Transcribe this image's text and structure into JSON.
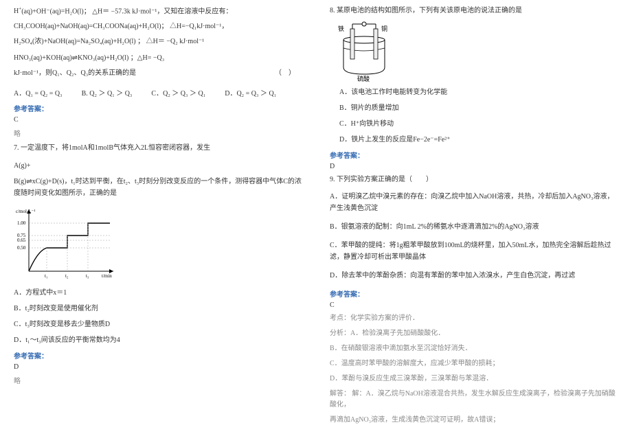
{
  "left": {
    "eq1_prefix": "H",
    "eq1": "(aq)+OH⁻(aq)=H₂O(l)； △H＝ −57.3k kJ·mol⁻¹，又知在溶液中反应有：",
    "eq2": "CH₃COOH(aq)+NaOH(aq)=CH₃COONa(aq)+H₂O(l)； △H=−Q₁kJ·mol⁻¹，",
    "eq3": "H₂SO₄(浓)+NaOH(aq)=Na₂SO₄(aq)+H₂O(l) ； △H＝ −Q₂ kJ·mol⁻¹",
    "eq4": "HNO₃(aq)+KOH(aq)⇌KNO₃(aq)+H₂O(l) ；△H= −Q₃",
    "eq5": "kJ·mol⁻¹，则Q₁、Q₂、Q₃的关系正确的是",
    "paren": "（　）",
    "optA": "A．Q₁ = Q₂ = Q₃",
    "optB": "B. Q₂ ＞ Q₁ ＞ Q₃",
    "optC": "C．Q₂ ＞ Q₃ ＞ Q₁",
    "optD": "D．Q₂ = Q₃ ＞ Q₁",
    "ans_label": "参考答案：",
    "ans6": "C",
    "omit": "略",
    "q7": "7. 一定温度下，将1molA和1molB气体充入2L恒容密闭容器，发生",
    "q7_eqA": "A(g)+",
    "q7_eqB": "B(g)⇌xC(g)+D(s)，t₁时达到平衡，在t₂、t₃时刻分别改变反应的一个条件，测得容器中气体C的浓度随时间变化如图所示，正确的是",
    "q7A": "A．方程式中x＝1",
    "q7B": "B．t₂时刻改变是使用催化剂",
    "q7C": "C．t₃时刻改变是移去少量物质D",
    "q7D": "D．t₁～t₃间该反应的平衡常数均为4",
    "ans7": "D"
  },
  "right": {
    "q8": "8. 某原电池的结构如图所示，下列有关该原电池的说法正确的是",
    "diag_label_left": "铁",
    "diag_label_right": "铜",
    "diag_label_bottom": "硫酸",
    "q8A": "A．该电池工作时电能转变为化学能",
    "q8B": "B．铜片的质量增加",
    "q8C": "C．H⁺向铁片移动",
    "q8D": "D．铁片上发生的反应是Fe−2e⁻=Fe²⁺",
    "ans_label": "参考答案：",
    "ans8": "D",
    "q9": "9. 下列实验方案正确的是（　　）",
    "q9A": "A．证明溴乙烷中溴元素的存在：向溴乙烷中加入NaOH溶液，共热，冷却后加入AgNO₃溶液，产生浅黄色沉淀",
    "q9B": "B．银氨溶液的配制：向1mL 2%的稀氨水中逐滴滴加2%的AgNO₃溶液",
    "q9C": "C．苯甲酸的提纯：将1g粗苯甲酸放到100mL的烧杯里，加入50mL水，加热完全溶解后趁热过滤，静置冷却可析出苯甲酸晶体",
    "q9D": "D．除去苯中的苯酚杂质：向混有苯酚的苯中加入浓溴水，产生白色沉淀，再过滤",
    "ans9": "C",
    "exp_label": "考点：化学实验方案的评价．",
    "exp_fx": "分析：A．检验溴离子先加硝酸酸化．",
    "exp_B": "B．在硝酸银溶液中滴加氨水至沉淀恰好消失．",
    "exp_C": "C．温度高时苯甲酸的溶解度大，应减少苯甲酸的损耗；",
    "exp_D": "D．苯酚与溴反应生成三溴苯酚，三溴苯酚与苯混溶．",
    "exp_sol1": "解答： 解：A．溴乙烷与NaOH溶液混合共热，发生水解反应生成溴离子，检验溴离子先加硝酸酸化，",
    "exp_sol2": "再滴加AgNO₃溶液，生成浅黄色沉淀可证明，故A错误；"
  },
  "chart_data": {
    "type": "line",
    "xlabel": "t/min",
    "ylabel": "c/mol·L⁻¹",
    "yticks": [
      0.5,
      0.65,
      0.75,
      1.0
    ],
    "xticks_labels": [
      "t₁",
      "t₂",
      "t₃"
    ],
    "series": [
      {
        "name": "C浓度",
        "description": "0→t₁ 曲线上升至0.50并保持；t₂ 处阶跃升至0.75并保持；t₃ 处阶跃升至1.00并保持"
      }
    ],
    "title": ""
  }
}
